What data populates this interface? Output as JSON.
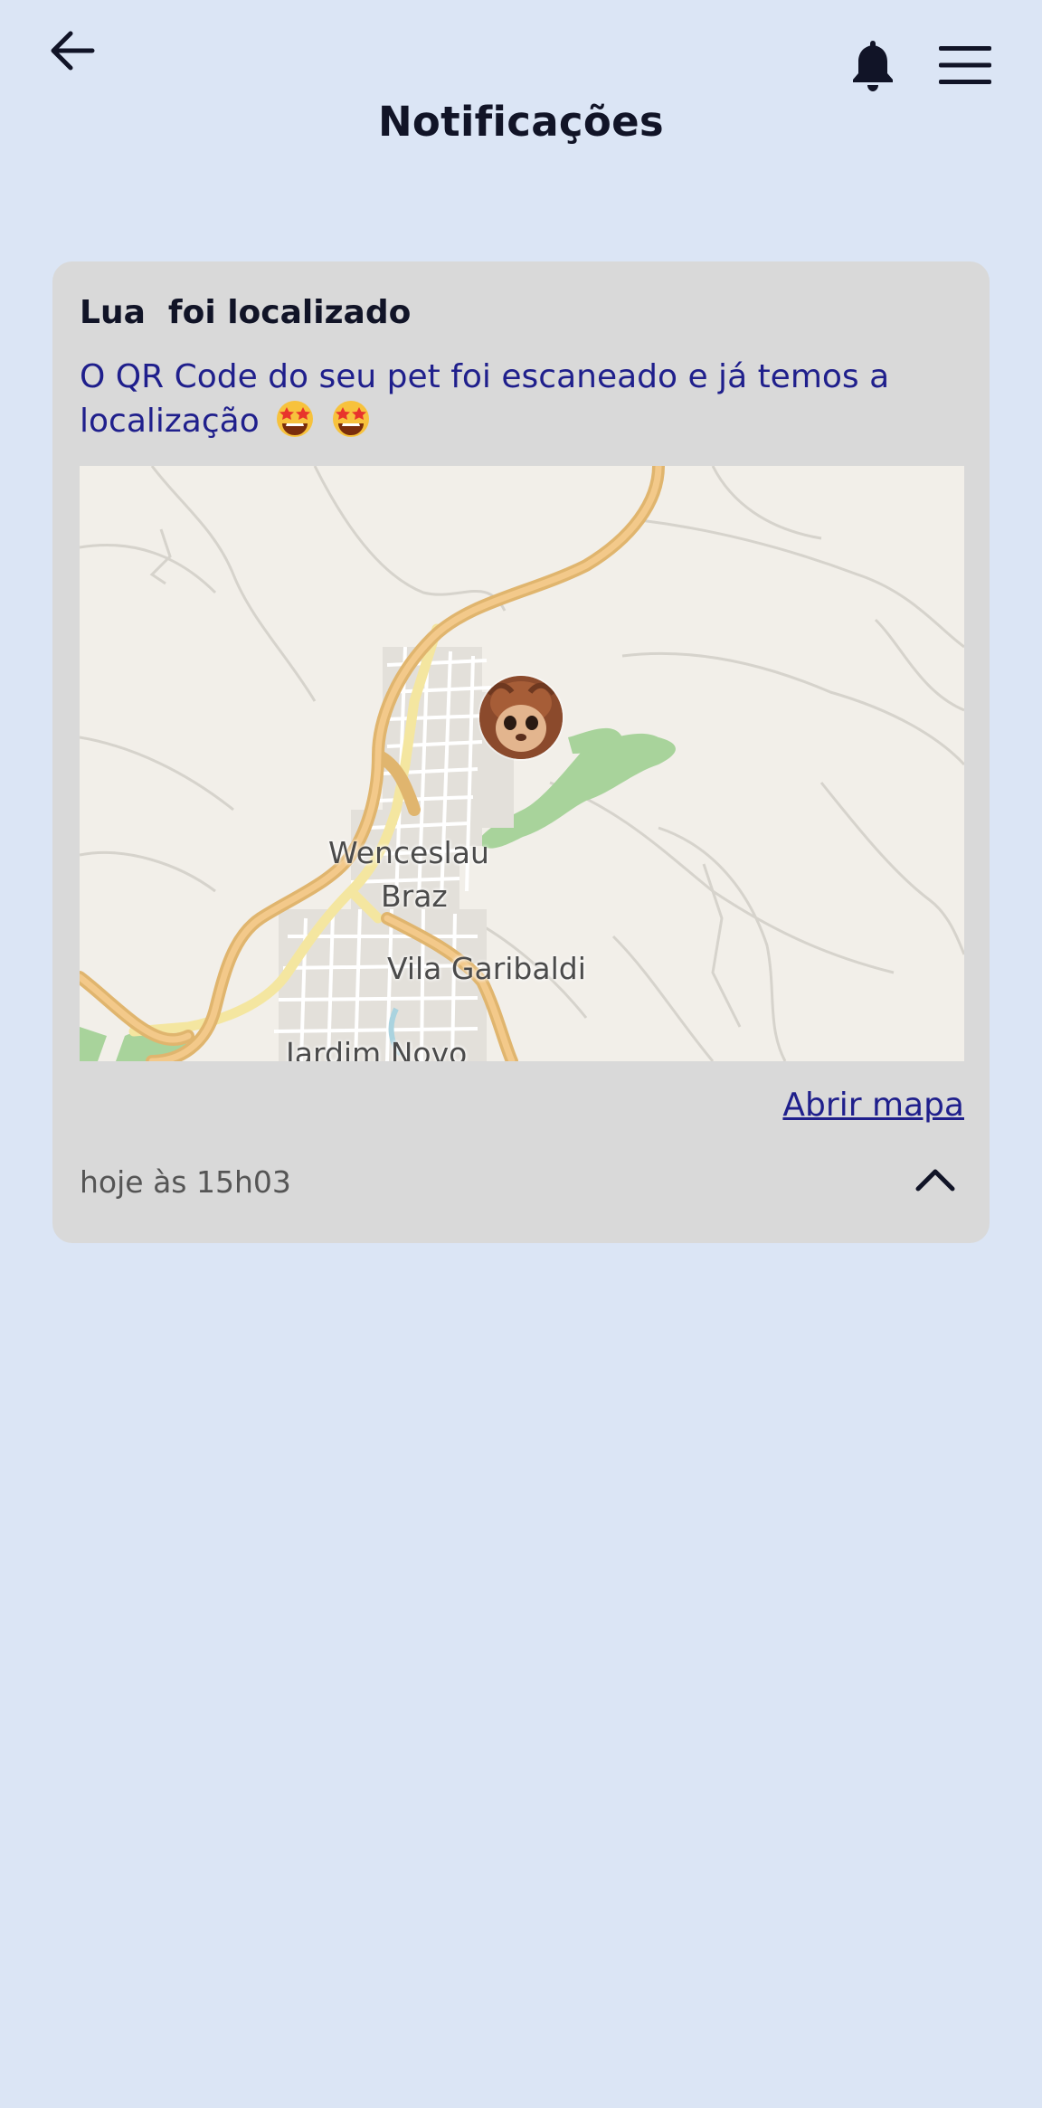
{
  "header": {
    "title": "Notificações",
    "back_icon": "arrow-left-icon",
    "bell_icon": "bell-icon",
    "menu_icon": "hamburger-menu-icon"
  },
  "notification": {
    "title": "Lua  foi localizado",
    "message": "O QR Code do seu pet foi escaneado e já temos a localização",
    "emoji": "star-struck-emoji",
    "map": {
      "labels": {
        "wenceslau": "Wenceslau",
        "braz": "Braz",
        "vila_garibaldi": "Vila Garibaldi",
        "jardim_novo": "Jardim Novo"
      },
      "marker_icon": "pet-avatar-marker"
    },
    "open_map_label": "Abrir mapa",
    "time": "hoje às 15h03",
    "collapse_icon": "chevron-up-icon"
  },
  "colors": {
    "background": "#dbe5f5",
    "card": "#d9d9d9",
    "accent_text": "#1f1f8c",
    "title_text": "#111427"
  }
}
